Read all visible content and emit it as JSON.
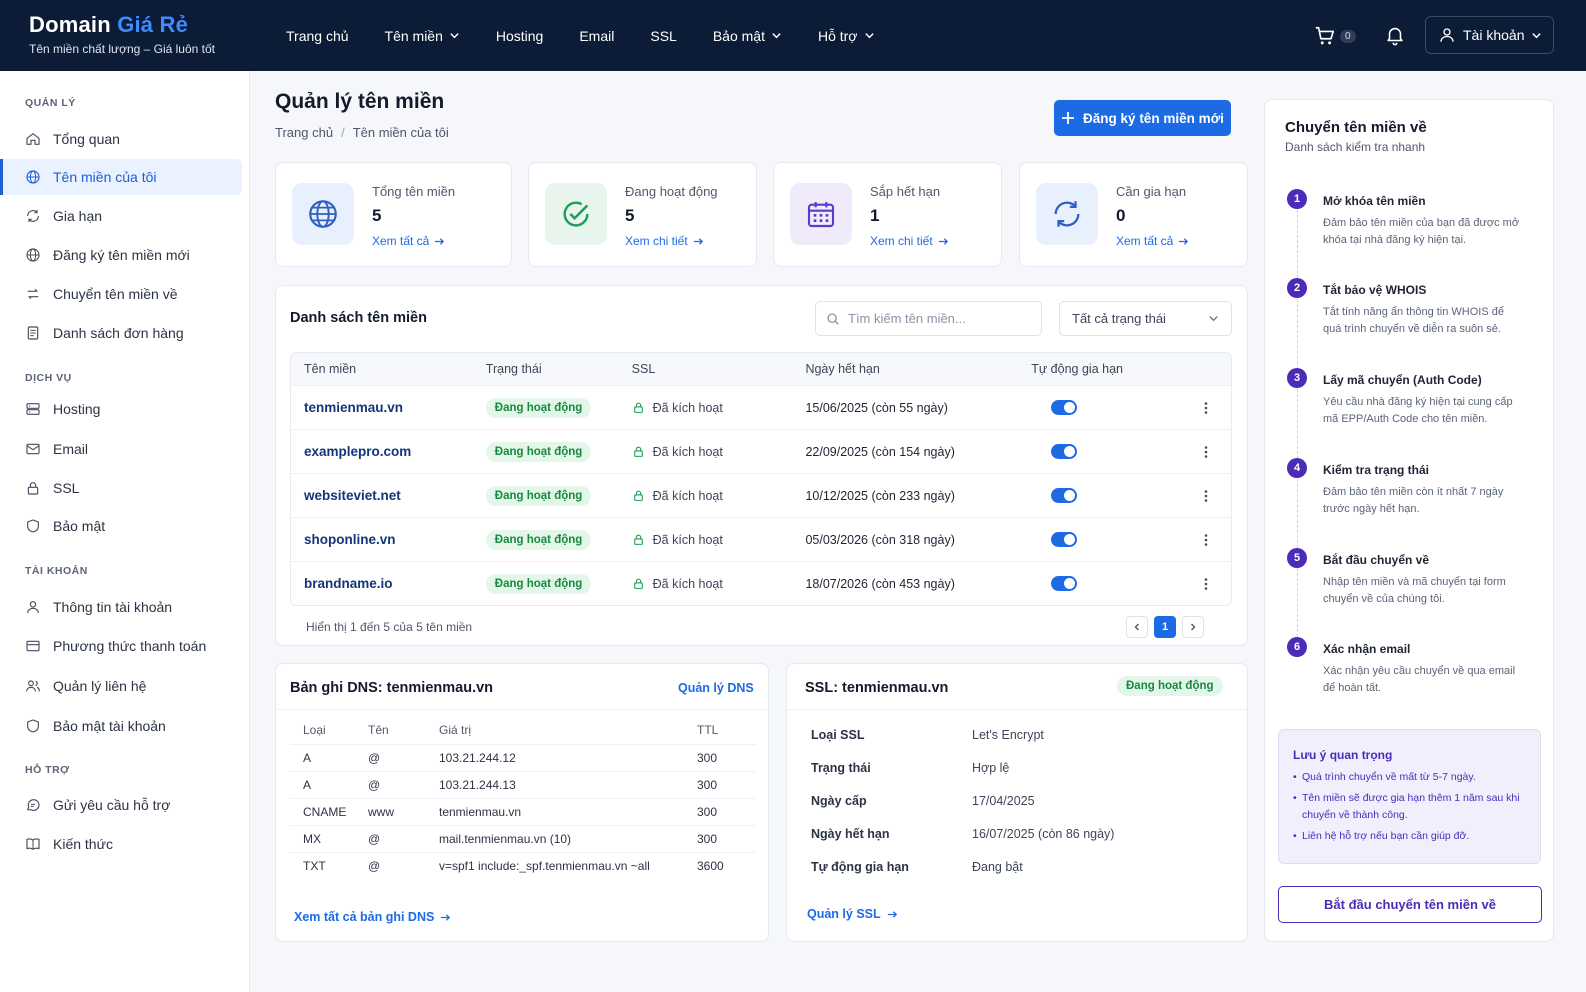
{
  "brand": {
    "name_part1": "Domain ",
    "name_part2": "Giá Rẻ",
    "tagline": "Tên miền chất lượng – Giá luôn tốt"
  },
  "nav": {
    "items": [
      "Trang chủ",
      "Tên miền",
      "Hosting",
      "Email",
      "SSL",
      "Bảo mật",
      "Hỗ trợ"
    ]
  },
  "header": {
    "cart_count": "0",
    "account_label": "Tài khoản"
  },
  "sidebar": {
    "sections": [
      {
        "title": "QUẢN LÝ",
        "items": [
          "Tổng quan",
          "Tên miền của tôi",
          "Gia hạn",
          "Đăng ký tên miền mới",
          "Chuyển tên miền về",
          "Danh sách đơn hàng"
        ]
      },
      {
        "title": "DỊCH VỤ",
        "items": [
          "Hosting",
          "Email",
          "SSL",
          "Bảo mật"
        ]
      },
      {
        "title": "TÀI KHOẢN",
        "items": [
          "Thông tin tài khoản",
          "Phương thức thanh toán",
          "Quản lý liên hệ",
          "Bảo mật tài khoản"
        ]
      },
      {
        "title": "HỖ TRỢ",
        "items": [
          "Gửi yêu cầu hỗ trợ",
          "Kiến thức"
        ]
      }
    ],
    "active_item": "Tên miền của tôi"
  },
  "page": {
    "title": "Quản lý tên miền",
    "breadcrumb": [
      "Trang chủ",
      "Tên miền của tôi"
    ],
    "register_button": "Đăng ký tên miền mới"
  },
  "stats": [
    {
      "label": "Tổng tên miền",
      "value": "5",
      "link": "Xem tất cả",
      "icon": "globe-icon",
      "color": "#2f5fbf"
    },
    {
      "label": "Đang hoạt động",
      "value": "5",
      "link": "Xem chi tiết",
      "icon": "check-circle-icon",
      "color": "#1f9d55"
    },
    {
      "label": "Sắp hết hạn",
      "value": "1",
      "link": "Xem chi tiết",
      "icon": "calendar-icon",
      "color": "#5b3cc4"
    },
    {
      "label": "Cần gia hạn",
      "value": "0",
      "link": "Xem tất cả",
      "icon": "refresh-icon",
      "color": "#2f5fbf"
    }
  ],
  "domain_list": {
    "title": "Danh sách tên miền",
    "search_placeholder": "Tìm kiếm tên miền...",
    "filter_value": "Tất cả trạng thái",
    "columns": [
      "Tên miền",
      "Trạng thái",
      "SSL",
      "Ngày hết hạn",
      "Tự động gia hạn"
    ],
    "rows": [
      {
        "domain": "tenmienmau.vn",
        "status": "Đang hoạt động",
        "ssl": "Đã kích hoạt",
        "expiry": "15/06/2025 (còn 55 ngày)",
        "auto_renew": true
      },
      {
        "domain": "examplepro.com",
        "status": "Đang hoạt động",
        "ssl": "Đã kích hoạt",
        "expiry": "22/09/2025 (còn 154 ngày)",
        "auto_renew": true
      },
      {
        "domain": "websiteviet.net",
        "status": "Đang hoạt động",
        "ssl": "Đã kích hoạt",
        "expiry": "10/12/2025 (còn 233 ngày)",
        "auto_renew": true
      },
      {
        "domain": "shoponline.vn",
        "status": "Đang hoạt động",
        "ssl": "Đã kích hoạt",
        "expiry": "05/03/2026 (còn 318 ngày)",
        "auto_renew": true
      },
      {
        "domain": "brandname.io",
        "status": "Đang hoạt động",
        "ssl": "Đã kích hoạt",
        "expiry": "18/07/2026 (còn 453 ngày)",
        "auto_renew": true
      }
    ],
    "footer_text": "Hiển thị 1 đến 5 của 5 tên miền",
    "current_page": "1"
  },
  "dns": {
    "title": "Bản ghi DNS: tenmienmau.vn",
    "manage_link": "Quản lý DNS",
    "columns": [
      "Loại",
      "Tên",
      "Giá trị",
      "TTL"
    ],
    "rows": [
      {
        "type": "A",
        "name": "@",
        "value": "103.21.244.12",
        "ttl": "300"
      },
      {
        "type": "A",
        "name": "@",
        "value": "103.21.244.13",
        "ttl": "300"
      },
      {
        "type": "CNAME",
        "name": "www",
        "value": "tenmienmau.vn",
        "ttl": "300"
      },
      {
        "type": "MX",
        "name": "@",
        "value": "mail.tenmienmau.vn (10)",
        "ttl": "300"
      },
      {
        "type": "TXT",
        "name": "@",
        "value": "v=spf1 include:_spf.tenmienmau.vn ~all",
        "ttl": "3600"
      }
    ],
    "view_all_link": "Xem tất cả bản ghi DNS"
  },
  "ssl": {
    "title": "SSL: tenmienmau.vn",
    "status_badge": "Đang hoạt động",
    "fields": [
      {
        "key": "Loại SSL",
        "value": "Let's Encrypt"
      },
      {
        "key": "Trạng thái",
        "value": "Hợp lệ"
      },
      {
        "key": "Ngày cấp",
        "value": "17/04/2025"
      },
      {
        "key": "Ngày hết hạn",
        "value": "16/07/2025 (còn 86 ngày)"
      },
      {
        "key": "Tự động gia hạn",
        "value": "Đang bật"
      }
    ],
    "manage_link": "Quản lý SSL"
  },
  "transfer": {
    "title": "Chuyển tên miền về",
    "subtitle": "Danh sách kiểm tra nhanh",
    "steps": [
      {
        "num": "1",
        "title": "Mở khóa tên miền",
        "desc": "Đảm bảo tên miền của bạn đã được mở khóa tại nhà đăng ký hiện tại."
      },
      {
        "num": "2",
        "title": "Tắt bảo vệ WHOIS",
        "desc": "Tắt tính năng ẩn thông tin WHOIS để quá trình chuyển về diễn ra suôn sẻ."
      },
      {
        "num": "3",
        "title": "Lấy mã chuyển (Auth Code)",
        "desc": "Yêu cầu nhà đăng ký hiện tại cung cấp mã EPP/Auth Code cho tên miền."
      },
      {
        "num": "4",
        "title": "Kiểm tra trạng thái",
        "desc": "Đảm bảo tên miền còn ít nhất 7 ngày trước ngày hết hạn."
      },
      {
        "num": "5",
        "title": "Bắt đầu chuyển về",
        "desc": "Nhập tên miền và mã chuyển tại form chuyển về của chúng tôi."
      },
      {
        "num": "6",
        "title": "Xác nhận email",
        "desc": "Xác nhận yêu cầu chuyển về qua email để hoàn tất."
      }
    ],
    "note": {
      "title": "Lưu ý quan trọng",
      "items": [
        "Quá trình chuyển về mất từ 5-7 ngày.",
        "Tên miền sẽ được gia hạn thêm 1 năm sau khi chuyển về thành công.",
        "Liên hệ hỗ trợ nếu bạn cần giúp đỡ."
      ]
    },
    "start_button": "Bắt đầu chuyển tên miền về"
  }
}
